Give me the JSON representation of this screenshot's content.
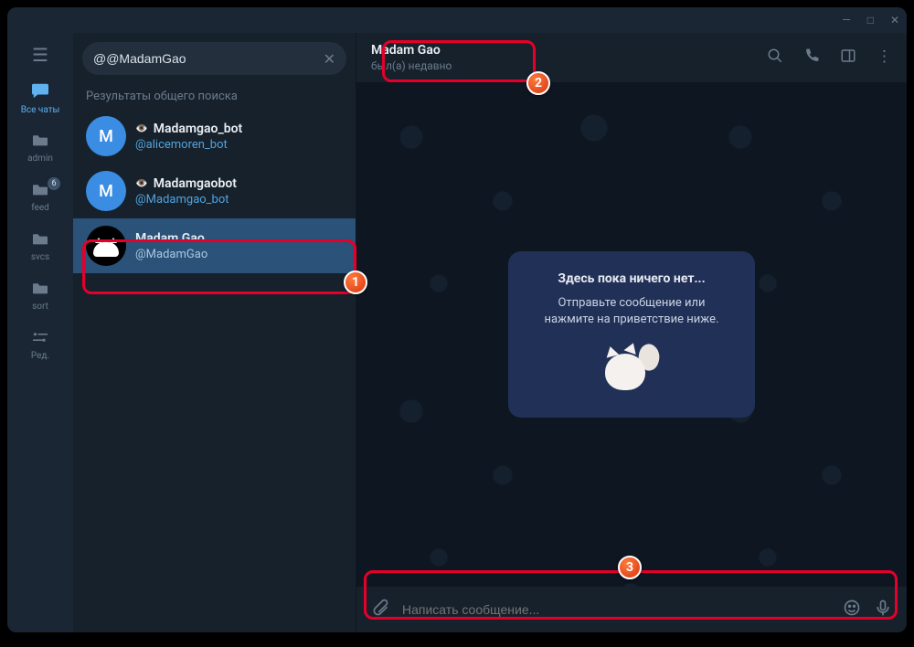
{
  "window": {
    "minimize": "—",
    "maximize": "□",
    "close": "✕"
  },
  "rail": {
    "items": [
      {
        "label": "Все чаты",
        "icon": "chat-icon",
        "active": true
      },
      {
        "label": "admin",
        "icon": "folder-icon"
      },
      {
        "label": "feed",
        "icon": "folder-icon",
        "badge": "6"
      },
      {
        "label": "svcs",
        "icon": "folder-icon"
      },
      {
        "label": "sort",
        "icon": "folder-icon"
      },
      {
        "label": "Ред.",
        "icon": "settings-icon"
      }
    ]
  },
  "search": {
    "value": "@@MadamGao",
    "section_title": "Результаты общего поиска",
    "results": [
      {
        "name": "Madamgao_bot",
        "handle": "@alicemoren_bot",
        "bot": true,
        "avatar_letter": "M",
        "avatar_kind": "blue"
      },
      {
        "name": "Madamgaobot",
        "handle": "@Madamgao_bot",
        "bot": true,
        "avatar_letter": "M",
        "avatar_kind": "blue"
      },
      {
        "name": "Madam Gao",
        "handle": "@MadamGao",
        "bot": false,
        "avatar_kind": "cat",
        "selected": true
      }
    ]
  },
  "chat": {
    "name": "Madam Gao",
    "status": "был(а) недавно",
    "empty_title": "Здесь пока ничего нет...",
    "empty_sub": "Отправьте сообщение или нажмите на приветствие ниже.",
    "input_placeholder": "Написать сообщение..."
  },
  "annotations": {
    "b1": "1",
    "b2": "2",
    "b3": "3"
  }
}
